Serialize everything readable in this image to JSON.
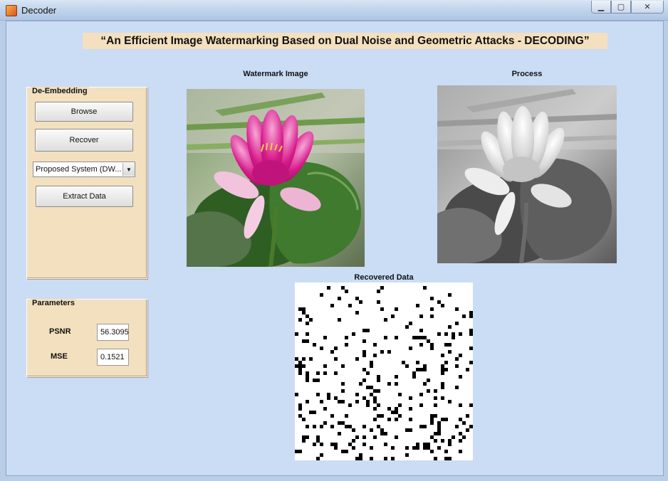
{
  "window": {
    "title": "Decoder",
    "minimize_glyph": "▁",
    "maximize_glyph": "▢",
    "close_glyph": "✕"
  },
  "header": {
    "title": "“An Efficient Image Watermarking Based on Dual Noise and Geometric Attacks - DECODING”"
  },
  "de_embedding": {
    "title": "De-Embedding",
    "browse_label": "Browse",
    "recover_label": "Recover",
    "method_select": {
      "value": "Proposed System (DW...",
      "arrow": "▼"
    },
    "extract_label": "Extract Data"
  },
  "parameters": {
    "title": "Parameters",
    "psnr_label": "PSNR",
    "psnr_value": "56.3095",
    "mse_label": "MSE",
    "mse_value": "0.1521"
  },
  "images": {
    "watermark_label": "Watermark Image",
    "process_label": "Process",
    "recovered_label": "Recovered Data"
  },
  "colors": {
    "background": "#cbdcf5",
    "panel": "#f3e0bf",
    "lotus_petal": "#d81b8c",
    "leaf": "#3f7a2e"
  }
}
